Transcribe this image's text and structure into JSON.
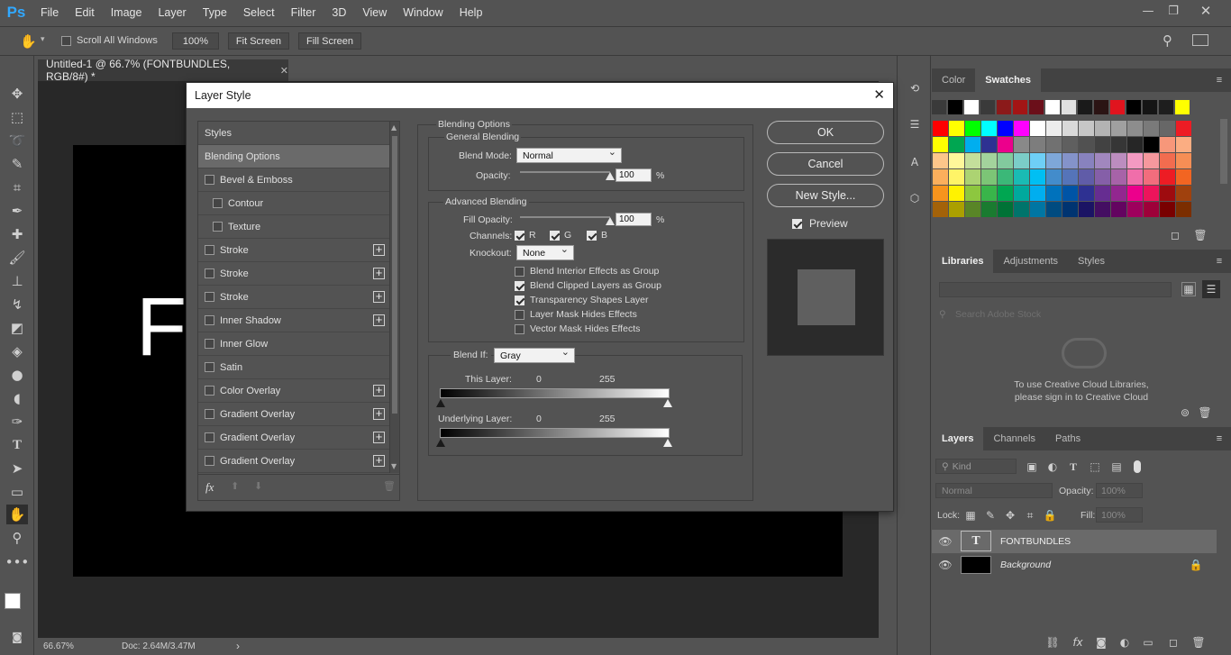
{
  "menubar": {
    "logo": "Ps",
    "items": [
      "File",
      "Edit",
      "Image",
      "Layer",
      "Type",
      "Select",
      "Filter",
      "3D",
      "View",
      "Window",
      "Help"
    ]
  },
  "options": {
    "scroll_all_windows": "Scroll All Windows",
    "zoom_100": "100%",
    "fit_screen": "Fit Screen",
    "fill_screen": "Fill Screen"
  },
  "document": {
    "tab_title": "Untitled-1 @ 66.7% (FONTBUNDLES, RGB/8#) *",
    "canvas_text": "F",
    "zoom": "66.67%",
    "doc_size": "Doc: 2.64M/3.47M"
  },
  "dialog": {
    "title": "Layer Style",
    "styles_header": "Styles",
    "style_items": [
      {
        "label": "Blending Options",
        "checkbox": false,
        "plus": false,
        "selected": true
      },
      {
        "label": "Bevel & Emboss",
        "checkbox": true,
        "plus": false
      },
      {
        "label": "Contour",
        "checkbox": true,
        "plus": false,
        "indent": true
      },
      {
        "label": "Texture",
        "checkbox": true,
        "plus": false,
        "indent": true
      },
      {
        "label": "Stroke",
        "checkbox": true,
        "plus": true
      },
      {
        "label": "Stroke",
        "checkbox": true,
        "plus": true
      },
      {
        "label": "Stroke",
        "checkbox": true,
        "plus": true
      },
      {
        "label": "Inner Shadow",
        "checkbox": true,
        "plus": true
      },
      {
        "label": "Inner Glow",
        "checkbox": true,
        "plus": false
      },
      {
        "label": "Satin",
        "checkbox": true,
        "plus": false
      },
      {
        "label": "Color Overlay",
        "checkbox": true,
        "plus": true
      },
      {
        "label": "Gradient Overlay",
        "checkbox": true,
        "plus": true
      },
      {
        "label": "Gradient Overlay",
        "checkbox": true,
        "plus": true
      },
      {
        "label": "Gradient Overlay",
        "checkbox": true,
        "plus": true
      }
    ],
    "fx_label": "fx",
    "blending_options_title": "Blending Options",
    "general_blending": "General Blending",
    "blend_mode_label": "Blend Mode:",
    "blend_mode_value": "Normal",
    "opacity_label": "Opacity:",
    "opacity_value": "100",
    "opacity_fraction": 1.0,
    "percent": "%",
    "advanced_blending": "Advanced Blending",
    "fill_opacity_label": "Fill Opacity:",
    "fill_opacity_value": "100",
    "fill_opacity_fraction": 1.0,
    "channels_label": "Channels:",
    "channel_r": "R",
    "channel_g": "G",
    "channel_b": "B",
    "knockout_label": "Knockout:",
    "knockout_value": "None",
    "options": [
      {
        "label": "Blend Interior Effects as Group",
        "checked": false
      },
      {
        "label": "Blend Clipped Layers as Group",
        "checked": true
      },
      {
        "label": "Transparency Shapes Layer",
        "checked": true
      },
      {
        "label": "Layer Mask Hides Effects",
        "checked": false
      },
      {
        "label": "Vector Mask Hides Effects",
        "checked": false
      }
    ],
    "blend_if_label": "Blend If:",
    "blend_if_value": "Gray",
    "this_layer_label": "This Layer:",
    "this_layer_min": "0",
    "this_layer_max": "255",
    "underlying_layer_label": "Underlying Layer:",
    "underlying_min": "0",
    "underlying_max": "255",
    "ok": "OK",
    "cancel": "Cancel",
    "new_style": "New Style...",
    "preview": "Preview"
  },
  "swatches_panel": {
    "tabs": [
      "Color",
      "Swatches"
    ],
    "active": "Swatches",
    "top_row": [
      "#3a3a3a",
      "#000000",
      "#ffffff",
      "#3a3a3a",
      "#8b1a1a",
      "#a31515",
      "#6b0f1a",
      "#ffffff",
      "#e0e0e0",
      "#1a1a1a",
      "#2b1414",
      "#e0141e",
      "#000000",
      "#151515",
      "#1e1e1e",
      "#ffff00"
    ],
    "grid": [
      [
        "#ff0000",
        "#ffff00",
        "#00ff00",
        "#00ffff",
        "#0000ff",
        "#ff00ff",
        "#ffffff",
        "#ececec",
        "#d9d9d9",
        "#c6c6c6",
        "#b3b3b3",
        "#a0a0a0",
        "#8d8d8d",
        "#7a7a7a",
        "#676767",
        "#ed1c24"
      ],
      [
        "#ffff00",
        "#00a651",
        "#00aeef",
        "#2e3192",
        "#ec008c",
        "#898989",
        "#7d7d7d",
        "#717171",
        "#5f5f5f",
        "#515151",
        "#424242",
        "#363636",
        "#262626",
        "#000000",
        "#f7977a",
        "#fbad82"
      ],
      [
        "#fdc68a",
        "#fff79a",
        "#c4df9b",
        "#a3d39c",
        "#82ca9d",
        "#7bcdc8",
        "#6ecff6",
        "#7ea7d8",
        "#8493ca",
        "#8882be",
        "#a187be",
        "#bc8dbf",
        "#f49ac2",
        "#f6989d",
        "#f26c4f",
        "#f68e55"
      ],
      [
        "#fbaf5c",
        "#fff467",
        "#acd372",
        "#7cc576",
        "#3bb878",
        "#1abbb4",
        "#00bff3",
        "#438ccb",
        "#5574b9",
        "#605ca8",
        "#855fa8",
        "#a763a8",
        "#f06eaa",
        "#f26d7d",
        "#ed1c24",
        "#f26522"
      ],
      [
        "#f7941d",
        "#fff200",
        "#8dc73f",
        "#39b54a",
        "#00a651",
        "#00a99d",
        "#00aeef",
        "#0072bc",
        "#0054a6",
        "#2e3192",
        "#662d91",
        "#92278f",
        "#ec008c",
        "#ed145b",
        "#9e0b0f",
        "#a0410d"
      ],
      [
        "#a36209",
        "#aba000",
        "#598527",
        "#1a7b30",
        "#007236",
        "#00746b",
        "#0076a3",
        "#004b80",
        "#003471",
        "#1b1464",
        "#440e62",
        "#630460",
        "#9e005d",
        "#9e0039",
        "#790000",
        "#7b2e00"
      ]
    ]
  },
  "libraries_panel": {
    "tabs": [
      "Libraries",
      "Adjustments",
      "Styles"
    ],
    "active": "Libraries",
    "search_placeholder": "Search Adobe Stock",
    "message_line1": "To use Creative Cloud Libraries,",
    "message_line2": "please sign in to Creative Cloud"
  },
  "layers_panel": {
    "tabs": [
      "Layers",
      "Channels",
      "Paths"
    ],
    "active": "Layers",
    "kind_label": "Kind",
    "blend_mode": "Normal",
    "opacity_label": "Opacity:",
    "opacity_value": "100%",
    "lock_label": "Lock:",
    "fill_label": "Fill:",
    "fill_value": "100%",
    "layers": [
      {
        "name": "FONTBUNDLES",
        "type": "text",
        "selected": true
      },
      {
        "name": "Background",
        "type": "fill",
        "locked": true
      }
    ]
  },
  "icons": {
    "hand": "hand-icon",
    "search": "search-icon",
    "workspace": "workspace-icon",
    "close": "close-icon"
  }
}
